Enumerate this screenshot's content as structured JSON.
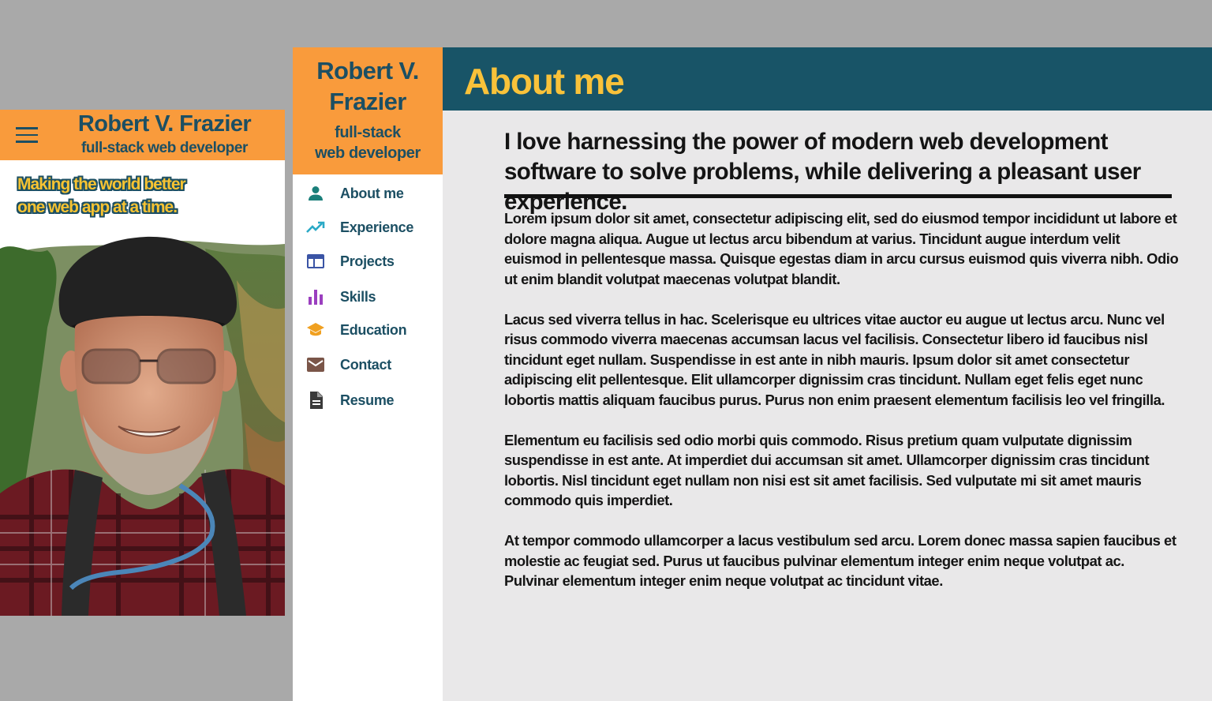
{
  "mobile": {
    "name": "Robert V. Frazier",
    "role": "full-stack web developer",
    "tagline_line1": "Making the world better",
    "tagline_line2": "one web app at a time.",
    "menu_icon": "hamburger-menu-icon"
  },
  "sidebar": {
    "name_line1": "Robert V.",
    "name_line2": "Frazier",
    "role_line1": "full-stack",
    "role_line2": "web developer",
    "items": [
      {
        "label": "About me",
        "icon": "person-icon",
        "color": "#1a7f7a"
      },
      {
        "label": "Experience",
        "icon": "trending-up-icon",
        "color": "#2aa9c6"
      },
      {
        "label": "Projects",
        "icon": "web-window-icon",
        "color": "#3a54a5"
      },
      {
        "label": "Skills",
        "icon": "bar-chart-icon",
        "color": "#9b3fbf"
      },
      {
        "label": "Education",
        "icon": "graduation-cap-icon",
        "color": "#f0a020"
      },
      {
        "label": "Contact",
        "icon": "mail-icon",
        "color": "#7a5548"
      },
      {
        "label": "Resume",
        "icon": "document-icon",
        "color": "#3a3a3a"
      }
    ]
  },
  "main": {
    "title": "About me",
    "lead": "I love harnessing the power of modern web development software to solve problems, while delivering a pleasant user experience.",
    "paragraphs": [
      "Lorem ipsum dolor sit amet, consectetur adipiscing elit, sed do eiusmod tempor incididunt ut labore et dolore magna aliqua. Augue ut lectus arcu bibendum at varius. Tincidunt augue interdum velit euismod in pellentesque massa. Quisque egestas diam in arcu cursus euismod quis viverra nibh. Odio ut enim blandit volutpat maecenas volutpat blandit.",
      "Lacus sed viverra tellus in hac. Scelerisque eu ultrices vitae auctor eu augue ut lectus arcu. Nunc vel risus commodo viverra maecenas accumsan lacus vel facilisis. Consectetur libero id faucibus nisl tincidunt eget nullam. Suspendisse in est ante in nibh mauris. Ipsum dolor sit amet consectetur adipiscing elit pellentesque. Elit ullamcorper dignissim cras tincidunt. Nullam eget felis eget nunc lobortis mattis aliquam faucibus purus. Purus non enim praesent elementum facilisis leo vel fringilla.",
      "Elementum eu facilisis sed odio morbi quis commodo. Risus pretium quam vulputate dignissim suspendisse in est ante. At imperdiet dui accumsan sit amet. Ullamcorper dignissim cras tincidunt lobortis. Nisl tincidunt eget nullam non nisi est sit amet facilisis. Sed vulputate mi sit amet mauris commodo quis imperdiet.",
      "At tempor commodo ullamcorper a lacus vestibulum sed arcu. Lorem donec massa sapien faucibus et molestie ac feugiat sed. Purus ut faucibus pulvinar elementum integer enim neque volutpat ac. Pulvinar elementum integer enim neque volutpat ac tincidunt vitae."
    ]
  },
  "colors": {
    "orange": "#f99b3c",
    "teal": "#185467",
    "yellow": "#f9c23a",
    "background": "#a9a9a9",
    "content_bg": "#e9e8e9"
  }
}
